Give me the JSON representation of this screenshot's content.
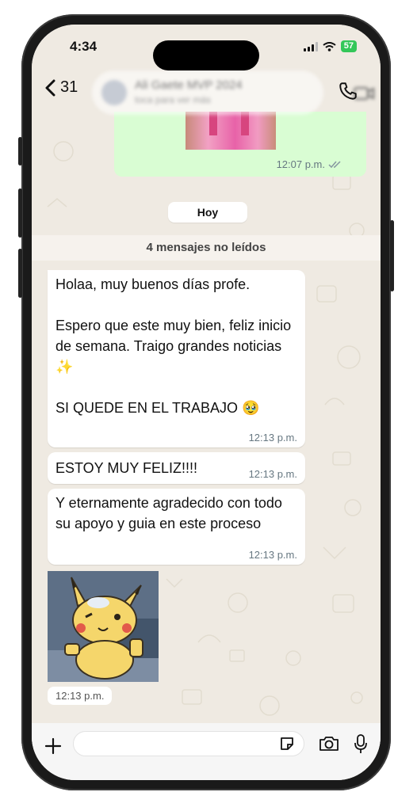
{
  "status_bar": {
    "time": "4:34",
    "battery": "57"
  },
  "header": {
    "back_count": "31",
    "contact_name": "Ali Gaete MVP 2024",
    "contact_sub": "toca para ver más"
  },
  "previous_message": {
    "time": "12:07 p.m."
  },
  "day_label": "Hoy",
  "unread_label": "4 mensajes no leídos",
  "messages": [
    {
      "text": "Holaa, muy buenos días profe.\n\nEspero que este muy bien, feliz inicio de semana. Traigo grandes noticias ✨\n\nSI QUEDE EN EL TRABAJO 🥹",
      "time": "12:13 p.m."
    },
    {
      "text": "ESTOY MUY FELIZ!!!!",
      "time": "12:13 p.m."
    },
    {
      "text": "Y eternamente agradecido con todo su apoyo y guia en este proceso",
      "time": "12:13 p.m."
    }
  ],
  "sticker": {
    "time": "12:13 p.m."
  },
  "composer": {
    "value": ""
  },
  "colors": {
    "outgoing_bubble": "#d9fdd3",
    "incoming_bubble": "#ffffff",
    "wallpaper": "#efeae2",
    "battery": "#34c759"
  },
  "icons": [
    "back-chevron-icon",
    "video-call-icon",
    "phone-call-icon",
    "plus-icon",
    "sticker-icon",
    "camera-icon",
    "microphone-icon",
    "double-check-icon",
    "wifi-icon",
    "signal-icon"
  ]
}
